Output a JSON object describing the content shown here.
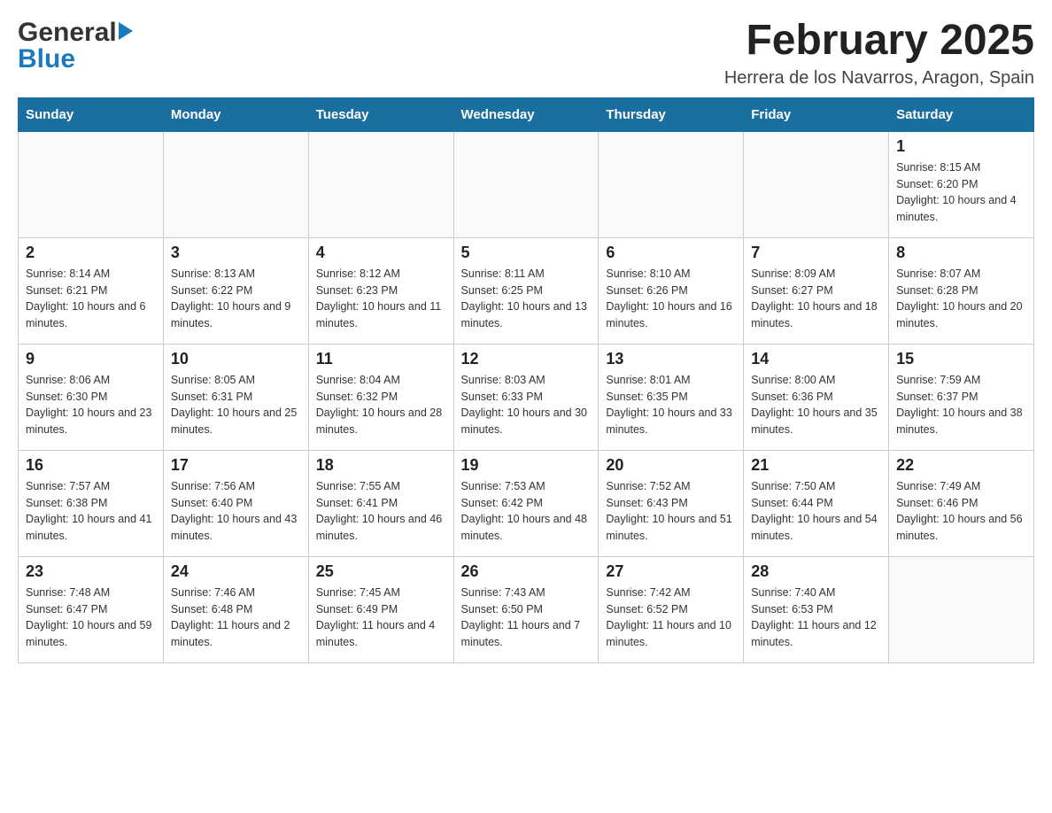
{
  "header": {
    "logo_general": "General",
    "logo_blue": "Blue",
    "month_title": "February 2025",
    "location": "Herrera de los Navarros, Aragon, Spain"
  },
  "weekdays": [
    "Sunday",
    "Monday",
    "Tuesday",
    "Wednesday",
    "Thursday",
    "Friday",
    "Saturday"
  ],
  "weeks": [
    [
      {
        "day": "",
        "info": ""
      },
      {
        "day": "",
        "info": ""
      },
      {
        "day": "",
        "info": ""
      },
      {
        "day": "",
        "info": ""
      },
      {
        "day": "",
        "info": ""
      },
      {
        "day": "",
        "info": ""
      },
      {
        "day": "1",
        "info": "Sunrise: 8:15 AM\nSunset: 6:20 PM\nDaylight: 10 hours and 4 minutes."
      }
    ],
    [
      {
        "day": "2",
        "info": "Sunrise: 8:14 AM\nSunset: 6:21 PM\nDaylight: 10 hours and 6 minutes."
      },
      {
        "day": "3",
        "info": "Sunrise: 8:13 AM\nSunset: 6:22 PM\nDaylight: 10 hours and 9 minutes."
      },
      {
        "day": "4",
        "info": "Sunrise: 8:12 AM\nSunset: 6:23 PM\nDaylight: 10 hours and 11 minutes."
      },
      {
        "day": "5",
        "info": "Sunrise: 8:11 AM\nSunset: 6:25 PM\nDaylight: 10 hours and 13 minutes."
      },
      {
        "day": "6",
        "info": "Sunrise: 8:10 AM\nSunset: 6:26 PM\nDaylight: 10 hours and 16 minutes."
      },
      {
        "day": "7",
        "info": "Sunrise: 8:09 AM\nSunset: 6:27 PM\nDaylight: 10 hours and 18 minutes."
      },
      {
        "day": "8",
        "info": "Sunrise: 8:07 AM\nSunset: 6:28 PM\nDaylight: 10 hours and 20 minutes."
      }
    ],
    [
      {
        "day": "9",
        "info": "Sunrise: 8:06 AM\nSunset: 6:30 PM\nDaylight: 10 hours and 23 minutes."
      },
      {
        "day": "10",
        "info": "Sunrise: 8:05 AM\nSunset: 6:31 PM\nDaylight: 10 hours and 25 minutes."
      },
      {
        "day": "11",
        "info": "Sunrise: 8:04 AM\nSunset: 6:32 PM\nDaylight: 10 hours and 28 minutes."
      },
      {
        "day": "12",
        "info": "Sunrise: 8:03 AM\nSunset: 6:33 PM\nDaylight: 10 hours and 30 minutes."
      },
      {
        "day": "13",
        "info": "Sunrise: 8:01 AM\nSunset: 6:35 PM\nDaylight: 10 hours and 33 minutes."
      },
      {
        "day": "14",
        "info": "Sunrise: 8:00 AM\nSunset: 6:36 PM\nDaylight: 10 hours and 35 minutes."
      },
      {
        "day": "15",
        "info": "Sunrise: 7:59 AM\nSunset: 6:37 PM\nDaylight: 10 hours and 38 minutes."
      }
    ],
    [
      {
        "day": "16",
        "info": "Sunrise: 7:57 AM\nSunset: 6:38 PM\nDaylight: 10 hours and 41 minutes."
      },
      {
        "day": "17",
        "info": "Sunrise: 7:56 AM\nSunset: 6:40 PM\nDaylight: 10 hours and 43 minutes."
      },
      {
        "day": "18",
        "info": "Sunrise: 7:55 AM\nSunset: 6:41 PM\nDaylight: 10 hours and 46 minutes."
      },
      {
        "day": "19",
        "info": "Sunrise: 7:53 AM\nSunset: 6:42 PM\nDaylight: 10 hours and 48 minutes."
      },
      {
        "day": "20",
        "info": "Sunrise: 7:52 AM\nSunset: 6:43 PM\nDaylight: 10 hours and 51 minutes."
      },
      {
        "day": "21",
        "info": "Sunrise: 7:50 AM\nSunset: 6:44 PM\nDaylight: 10 hours and 54 minutes."
      },
      {
        "day": "22",
        "info": "Sunrise: 7:49 AM\nSunset: 6:46 PM\nDaylight: 10 hours and 56 minutes."
      }
    ],
    [
      {
        "day": "23",
        "info": "Sunrise: 7:48 AM\nSunset: 6:47 PM\nDaylight: 10 hours and 59 minutes."
      },
      {
        "day": "24",
        "info": "Sunrise: 7:46 AM\nSunset: 6:48 PM\nDaylight: 11 hours and 2 minutes."
      },
      {
        "day": "25",
        "info": "Sunrise: 7:45 AM\nSunset: 6:49 PM\nDaylight: 11 hours and 4 minutes."
      },
      {
        "day": "26",
        "info": "Sunrise: 7:43 AM\nSunset: 6:50 PM\nDaylight: 11 hours and 7 minutes."
      },
      {
        "day": "27",
        "info": "Sunrise: 7:42 AM\nSunset: 6:52 PM\nDaylight: 11 hours and 10 minutes."
      },
      {
        "day": "28",
        "info": "Sunrise: 7:40 AM\nSunset: 6:53 PM\nDaylight: 11 hours and 12 minutes."
      },
      {
        "day": "",
        "info": ""
      }
    ]
  ]
}
